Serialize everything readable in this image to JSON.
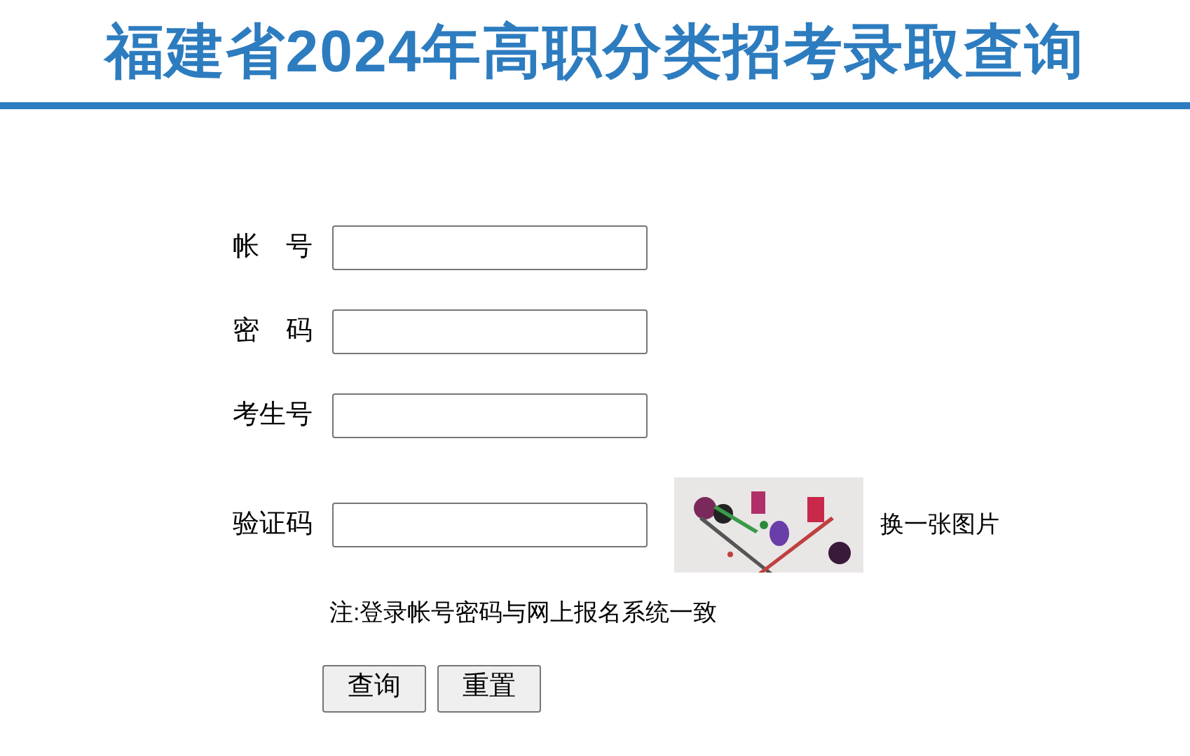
{
  "title": "福建省2024年高职分类招考录取查询",
  "fields": [
    {
      "label": "帐　号",
      "kind": "text"
    },
    {
      "label": "密　码",
      "kind": "password"
    },
    {
      "label": "考生号",
      "kind": "text"
    },
    {
      "label": "验证码",
      "kind": "captcha",
      "refresh": "换一张图片"
    }
  ],
  "note": "注:登录帐号密码与网上报名系统一致",
  "buttons": [
    "查询",
    "重置"
  ]
}
